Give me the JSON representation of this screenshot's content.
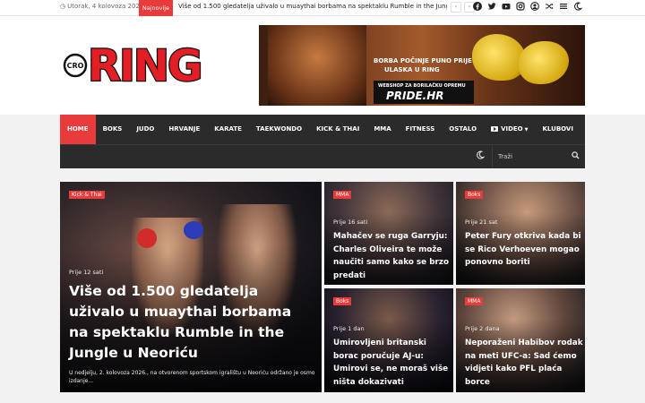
{
  "topbar": {
    "date": "Utorak, 4 kolovoza 2026",
    "ticker_label": "Najnovije",
    "ticker_text": "Više od 1.500 gledatelja uživalo u muaythai borbama na spektaklu Rumble in the Jungle ...",
    "social_icons": [
      "facebook-icon",
      "twitter-icon",
      "youtube-icon",
      "instagram-icon",
      "user-icon",
      "shuffle-icon",
      "menu-icon",
      "moon-icon"
    ]
  },
  "logo": {
    "text_small": "CRO",
    "text_big": "RING"
  },
  "banner": {
    "line1": "BORBA POČINJE PUNO PRIJE",
    "line2": "ULASKA U RING",
    "shop_line": "WEBSHOP ZA BORILAČKU OPREMU",
    "brand": "PRIDE.HR"
  },
  "nav": {
    "items": [
      "HOME",
      "BOKS",
      "JUDO",
      "HRVANJE",
      "KARATE",
      "TAEKWONDO",
      "KICK & THAI",
      "MMA",
      "FITNESS",
      "OSTALO",
      "VIDEO",
      "KLUBOVI"
    ],
    "search_placeholder": "Traži"
  },
  "featured": {
    "category": "Kick & Thai",
    "time": "Prije 12 sati",
    "title": "Više od 1.500 gledatelja uživalo u muaythai borbama na spektaklu Rumble in the Jungle u Neoriću",
    "excerpt": "U nedjelju, 2. kolovoza 2026., na otvorenom sportskom igralištu u Neoriću održano je osmo izdanje..."
  },
  "cards": [
    {
      "category": "MMA",
      "time": "Prije 16 sati",
      "title": "Mahačev se ruga Garryju: Charles Oliveira te može naučiti samo kako se brzo predati"
    },
    {
      "category": "Boks",
      "time": "Prije 21 sat",
      "title": "Peter Fury otkriva kada bi se Rico Verhoeven mogao ponovno boriti"
    },
    {
      "category": "Boks",
      "time": "Prije 1 dan",
      "title": "Umirovljeni britanski borac poručuje AJ-u: Umirovi se, ne moraš više ništa dokazivati"
    },
    {
      "category": "MMA",
      "time": "Prije 2 dana",
      "title": "Neporaženi Habibov rodak na meti UFC-a: Sad ćemo vidjeti kako PFL plaća borce"
    }
  ],
  "colors": {
    "accent": "#e93b3b",
    "nav_bg": "#2b2b2b"
  }
}
